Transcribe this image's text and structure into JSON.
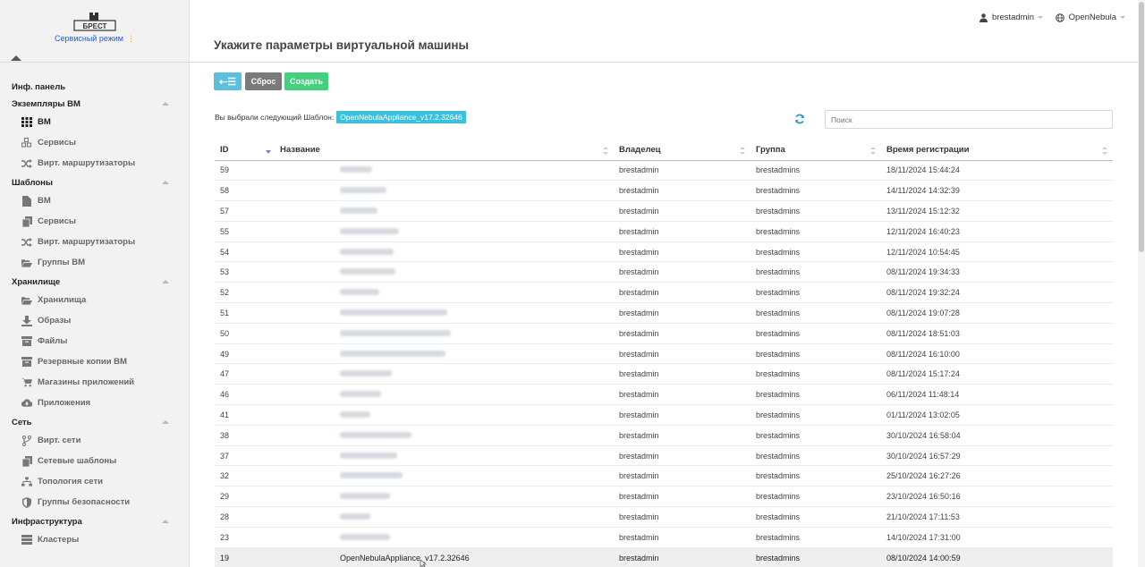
{
  "logo": {
    "text": "БРЕСТ",
    "mode_label": "Сервисный режим",
    "mode_dot": "⋮"
  },
  "header": {
    "title": "Укажите параметры виртуальной машины",
    "user": "brestadmin",
    "zone": "OpenNebula"
  },
  "sidebar": {
    "top_item": "Инф. панель",
    "sections": [
      {
        "title": "Экземпляры ВМ",
        "items": [
          {
            "label": "ВМ",
            "icon": "grid-icon",
            "active": true
          },
          {
            "label": "Сервисы",
            "icon": "cubes-icon"
          },
          {
            "label": "Вирт. маршрутизаторы",
            "icon": "random-icon"
          }
        ]
      },
      {
        "title": "Шаблоны",
        "items": [
          {
            "label": "ВМ",
            "icon": "file-icon"
          },
          {
            "label": "Сервисы",
            "icon": "copy-icon"
          },
          {
            "label": "Вирт. маршрутизаторы",
            "icon": "random-icon"
          },
          {
            "label": "Группы ВМ",
            "icon": "folder-open-icon"
          }
        ]
      },
      {
        "title": "Хранилище",
        "items": [
          {
            "label": "Хранилища",
            "icon": "folder-open-icon"
          },
          {
            "label": "Образы",
            "icon": "download-icon"
          },
          {
            "label": "Файлы",
            "icon": "archive-icon"
          },
          {
            "label": "Резервные копии ВМ",
            "icon": "archive-icon"
          },
          {
            "label": "Магазины приложений",
            "icon": "cart-icon"
          },
          {
            "label": "Приложения",
            "icon": "cloud-download-icon"
          }
        ]
      },
      {
        "title": "Сеть",
        "items": [
          {
            "label": "Вирт. сети",
            "icon": "code-fork-icon"
          },
          {
            "label": "Сетевые шаблоны",
            "icon": "copy-icon"
          },
          {
            "label": "Топология сети",
            "icon": "sitemap-icon"
          },
          {
            "label": "Группы безопасности",
            "icon": "shield-icon"
          }
        ]
      },
      {
        "title": "Инфраструктура",
        "items": [
          {
            "label": "Кластеры",
            "icon": "server-icon"
          }
        ]
      }
    ]
  },
  "toolbar": {
    "back_label": "⇠☰",
    "reset_label": "Сброс",
    "create_label": "Создать"
  },
  "selection": {
    "prefix": "Вы выбрали следующий Шаблон:",
    "template": "OpenNebulaAppliance_v17.2.32646"
  },
  "search": {
    "placeholder": "Поиск"
  },
  "table": {
    "columns": [
      "ID",
      "Название",
      "Владелец",
      "Группа",
      "Время регистрации"
    ],
    "rows": [
      {
        "id": "59",
        "name_hidden": true,
        "w": 36,
        "owner": "brestadmin",
        "group": "brestadmins",
        "time": "18/11/2024 15:44:24"
      },
      {
        "id": "58",
        "name_hidden": true,
        "w": 52,
        "owner": "brestadmin",
        "group": "brestadmins",
        "time": "14/11/2024 14:32:39"
      },
      {
        "id": "57",
        "name_hidden": true,
        "w": 42,
        "owner": "brestadmin",
        "group": "brestadmins",
        "time": "13/11/2024 15:12:32"
      },
      {
        "id": "55",
        "name_hidden": true,
        "w": 66,
        "owner": "brestadmin",
        "group": "brestadmins",
        "time": "12/11/2024 16:40:23"
      },
      {
        "id": "54",
        "name_hidden": true,
        "w": 60,
        "owner": "brestadmin",
        "group": "brestadmins",
        "time": "12/11/2024 10:54:45"
      },
      {
        "id": "53",
        "name_hidden": true,
        "w": 62,
        "owner": "brestadmin",
        "group": "brestadmins",
        "time": "08/11/2024 19:34:33"
      },
      {
        "id": "52",
        "name_hidden": true,
        "w": 44,
        "owner": "brestadmin",
        "group": "brestadmins",
        "time": "08/11/2024 19:32:24"
      },
      {
        "id": "51",
        "name_hidden": true,
        "w": 120,
        "owner": "brestadmin",
        "group": "brestadmins",
        "time": "08/11/2024 19:07:28"
      },
      {
        "id": "50",
        "name_hidden": true,
        "w": 124,
        "owner": "brestadmin",
        "group": "brestadmins",
        "time": "08/11/2024 18:51:03"
      },
      {
        "id": "49",
        "name_hidden": true,
        "w": 118,
        "owner": "brestadmin",
        "group": "brestadmins",
        "time": "08/11/2024 16:10:00"
      },
      {
        "id": "47",
        "name_hidden": true,
        "w": 58,
        "owner": "brestadmin",
        "group": "brestadmins",
        "time": "08/11/2024 15:17:24"
      },
      {
        "id": "46",
        "name_hidden": true,
        "w": 46,
        "owner": "brestadmin",
        "group": "brestadmins",
        "time": "06/11/2024 11:48:14"
      },
      {
        "id": "41",
        "name_hidden": true,
        "w": 34,
        "owner": "brestadmin",
        "group": "brestadmins",
        "time": "01/11/2024 13:02:05"
      },
      {
        "id": "38",
        "name_hidden": true,
        "w": 80,
        "owner": "brestadmin",
        "group": "brestadmins",
        "time": "30/10/2024 16:58:04"
      },
      {
        "id": "37",
        "name_hidden": true,
        "w": 64,
        "owner": "brestadmin",
        "group": "brestadmins",
        "time": "30/10/2024 16:57:29"
      },
      {
        "id": "32",
        "name_hidden": true,
        "w": 70,
        "owner": "brestadmin",
        "group": "brestadmins",
        "time": "25/10/2024 16:27:26"
      },
      {
        "id": "29",
        "name_hidden": true,
        "w": 56,
        "owner": "brestadmin",
        "group": "brestadmins",
        "time": "23/10/2024 16:50:16"
      },
      {
        "id": "28",
        "name_hidden": true,
        "w": 34,
        "owner": "brestadmin",
        "group": "brestadmins",
        "time": "21/10/2024 17:11:53"
      },
      {
        "id": "23",
        "name_hidden": true,
        "w": 56,
        "owner": "brestadmin",
        "group": "brestadmins",
        "time": "14/10/2024 17:31:00"
      },
      {
        "id": "19",
        "name": "OpenNebulaAppliance_v17.2.32646",
        "owner": "brestadmin",
        "group": "brestadmins",
        "time": "08/10/2024 14:00:59",
        "highlight": true
      }
    ]
  },
  "colors": {
    "accent": "#5bc0de",
    "create": "#43d17d",
    "reset": "#7a7a7a",
    "badge": "#3cc1dc",
    "link": "#2a5bd7"
  }
}
